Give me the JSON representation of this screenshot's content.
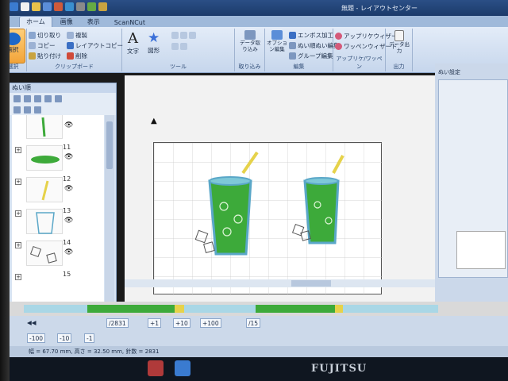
{
  "window": {
    "title": "無題 - レイアウトセンター"
  },
  "tabs": [
    {
      "label": "ホーム",
      "active": true
    },
    {
      "label": "画像",
      "active": false
    },
    {
      "label": "表示",
      "active": false
    },
    {
      "label": "ScanNCut",
      "active": false
    }
  ],
  "ribbon": {
    "select": {
      "label": "選択",
      "group": "選択"
    },
    "clipboard": {
      "cut": "切り取り",
      "copy": "コピー",
      "paste": "貼り付け",
      "duplicate": "複製",
      "layout_copy": "レイアウトコピー",
      "delete": "削除",
      "group": "クリップボード"
    },
    "tools": {
      "text": "文字",
      "shape": "図形",
      "group": "ツール"
    },
    "import": {
      "data_import": "データ取り込み",
      "group": "取り込み"
    },
    "edit": {
      "options": "オプション編集",
      "emboss": "エンボス加工",
      "stitch_edit": "ぬい順ぬい編集",
      "group_edit": "グループ編集",
      "group": "編集"
    },
    "applique": {
      "wizard": "アップリケウィザード",
      "patch_wizard": "ワッペンウィザード",
      "group": "アップリケ/ワッペン"
    },
    "output": {
      "label": "データ出力",
      "group": "出力"
    }
  },
  "left_panel": {
    "title": "ぬい順",
    "items": [
      {
        "num": "",
        "kind": "line-green"
      },
      {
        "num": "11",
        "kind": "leaf-green"
      },
      {
        "num": "12",
        "kind": "straw-yellow"
      },
      {
        "num": "13",
        "kind": "cup-outline"
      },
      {
        "num": "14",
        "kind": "ice-cubes"
      },
      {
        "num": "15",
        "kind": "empty"
      }
    ],
    "eye_glyph": "👁"
  },
  "right_panel": {
    "title": "ぬい設定"
  },
  "controls": {
    "total": "/2831",
    "step_1": "+1",
    "step_10": "+10",
    "step_100": "+100",
    "page": "/15",
    "minus_100": "-100",
    "minus_10": "-10",
    "minus_1": "-1"
  },
  "status": {
    "text": "幅 = 67.70 mm, 高さ = 32.50 mm, 針数 = 2831"
  },
  "brand": "FUJITSU",
  "colors": {
    "drink_green": "#3daa3a",
    "cup_blue": "#5aa7c8",
    "straw_yellow": "#e6d24a",
    "ribbon_blue": "#c6d6ec"
  }
}
